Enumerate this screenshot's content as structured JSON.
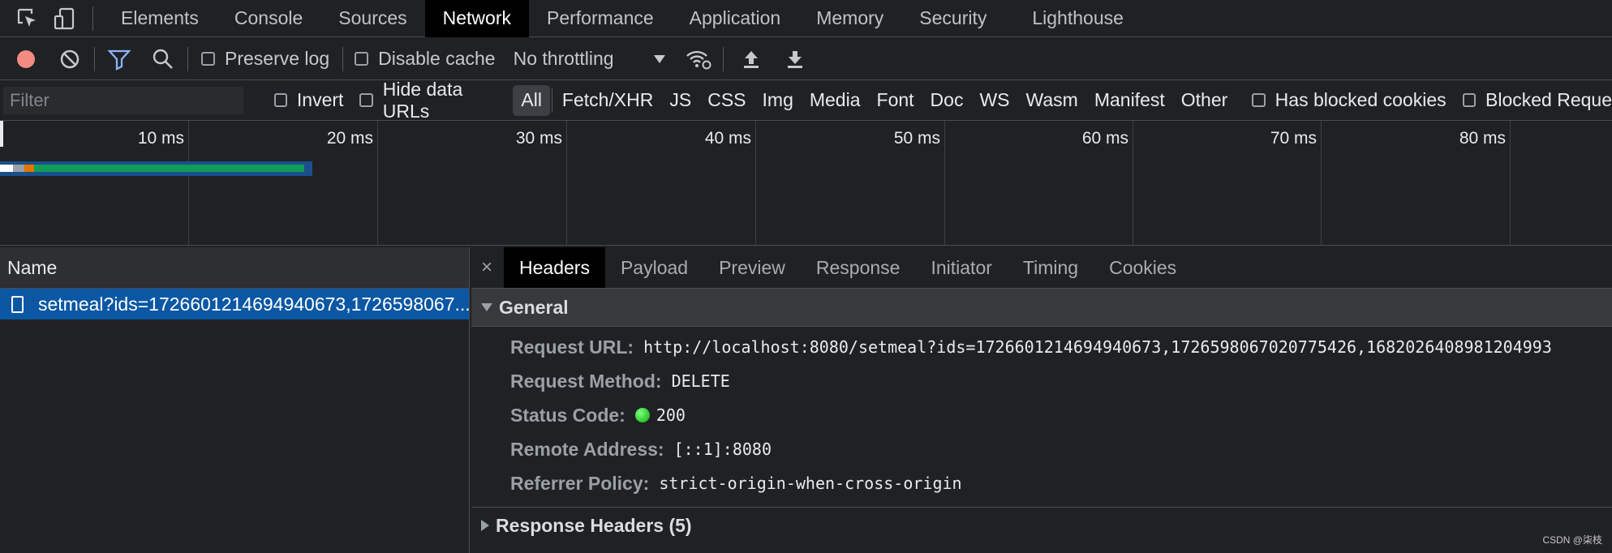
{
  "top_tabs": [
    "Elements",
    "Console",
    "Sources",
    "Network",
    "Performance",
    "Application",
    "Memory",
    "Security",
    "Lighthouse"
  ],
  "toolbar": {
    "preserve_log": "Preserve log",
    "disable_cache": "Disable cache",
    "throttling": "No throttling"
  },
  "filterbar": {
    "filter_placeholder": "Filter",
    "invert": "Invert",
    "hide_data_urls": "Hide data URLs",
    "types": [
      "All",
      "Fetch/XHR",
      "JS",
      "CSS",
      "Img",
      "Media",
      "Font",
      "Doc",
      "WS",
      "Wasm",
      "Manifest",
      "Other"
    ],
    "has_blocked_cookies": "Has blocked cookies",
    "blocked_requests": "Blocked Reque"
  },
  "overview": {
    "ticks": [
      "10 ms",
      "20 ms",
      "30 ms",
      "40 ms",
      "50 ms",
      "60 ms",
      "70 ms",
      "80 ms"
    ]
  },
  "requests": {
    "name_header": "Name",
    "items": [
      "setmeal?ids=172660121469494067​3,1726598067..."
    ]
  },
  "details": {
    "close": "×",
    "tabs": [
      "Headers",
      "Payload",
      "Preview",
      "Response",
      "Initiator",
      "Timing",
      "Cookies"
    ],
    "general_title": "General",
    "request_url_label": "Request URL:",
    "request_url": "http://localhost:8080/setmeal?ids=1726601214694940673,1726598067020775426,1682026408981204993",
    "request_method_label": "Request Method:",
    "request_method": "DELETE",
    "status_code_label": "Status Code:",
    "status_code": "200",
    "remote_address_label": "Remote Address:",
    "remote_address": "[::1]:8080",
    "referrer_policy_label": "Referrer Policy:",
    "referrer_policy": "strict-origin-when-cross-origin",
    "response_headers_title": "Response Headers (5)"
  },
  "watermark": "CSDN @柒枝",
  "colors": {
    "record": "#f28b82",
    "filter_icon": "#8ab4f8",
    "selected_row": "#0b57a4",
    "status_ok": "#0aa80a"
  }
}
